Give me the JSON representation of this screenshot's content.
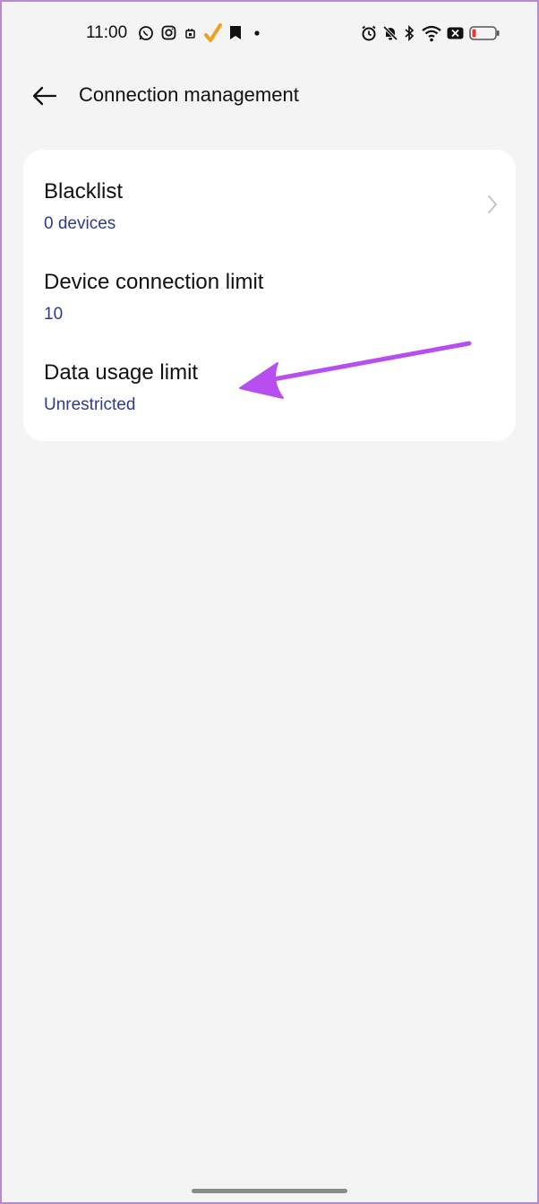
{
  "status_bar": {
    "time": "11:00",
    "left_icons": [
      "whatsapp-icon",
      "instagram-icon",
      "calendar-icon",
      "check-app-icon",
      "bookmark-app-icon",
      "dot-icon"
    ],
    "right_icons": [
      "alarm-icon",
      "mute-bell-icon",
      "bluetooth-icon",
      "wifi-icon",
      "no-sim-icon",
      "battery-low-icon"
    ],
    "accent_check": "#f0a020",
    "battery_color": "#e53935"
  },
  "header": {
    "title": "Connection management"
  },
  "settings": {
    "items": [
      {
        "label": "Blacklist",
        "value": "0 devices",
        "has_chevron": true
      },
      {
        "label": "Device connection limit",
        "value": "10",
        "has_chevron": false
      },
      {
        "label": "Data usage limit",
        "value": "Unrestricted",
        "has_chevron": false
      }
    ]
  },
  "annotation": {
    "color": "#b64ef0",
    "points_to": "Data usage limit"
  },
  "colors": {
    "background": "#f4f4f4",
    "card": "#ffffff",
    "subtitle": "#2b3c8f"
  }
}
